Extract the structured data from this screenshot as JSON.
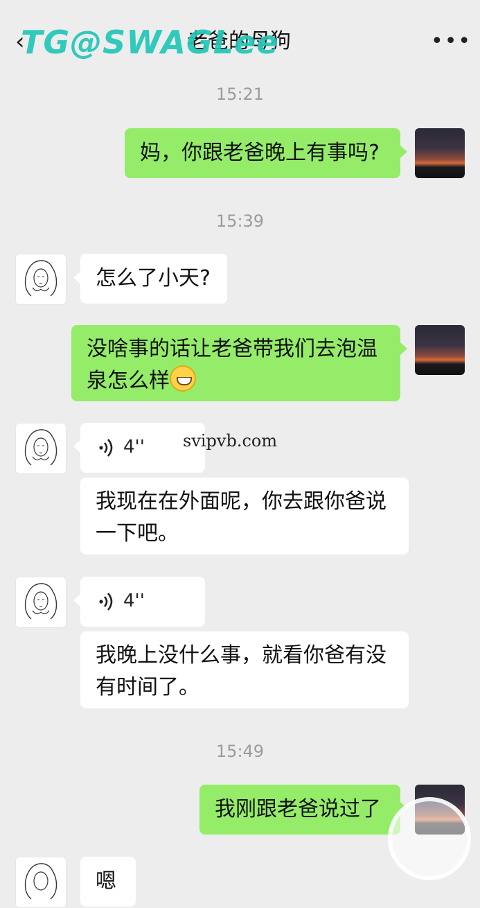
{
  "header": {
    "back_icon": "‹",
    "title": "老爸的母狗",
    "more_icon": "•••",
    "watermark": "TG@SWAGLee"
  },
  "messages": {
    "t1": "15:21",
    "m1": "妈，你跟老爸晚上有事吗?",
    "t2": "15:39",
    "m2": "怎么了小天?",
    "m3": "没啥事的话让老爸带我们去泡温泉怎么样",
    "v1": "4''",
    "m4": "我现在在外面呢，你去跟你爸说一下吧。",
    "v2": "4''",
    "m5": "我晚上没什么事，就看你爸有没有时间了。",
    "t3": "15:49",
    "m6": "我刚跟老爸说过了",
    "m7": "嗯"
  },
  "overlay": {
    "url": "svipvb.com"
  },
  "colors": {
    "me_bubble": "#95ec69",
    "them_bubble": "#ffffff",
    "background": "#ededed",
    "watermark": "#22c7b8"
  }
}
